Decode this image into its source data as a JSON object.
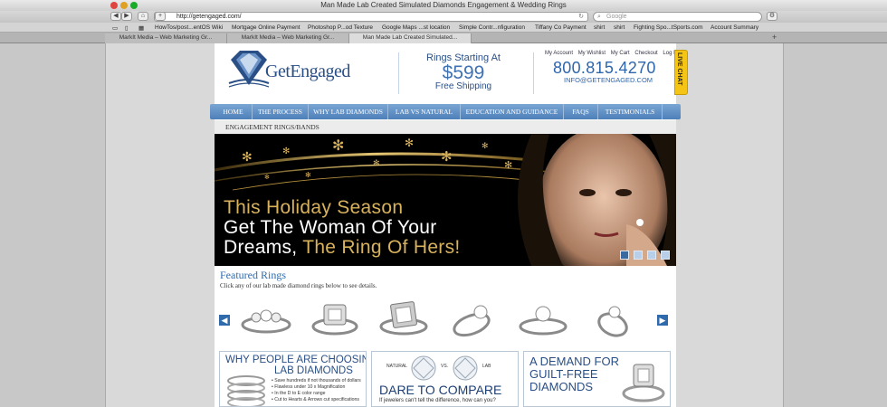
{
  "browser": {
    "window_title": "Man Made Lab Created Simulated Diamonds Engagement & Wedding Rings",
    "url": "http://getengaged.com/",
    "search_placeholder": "Google",
    "bookmarks": [
      "HowTos/post...entOS Wiki",
      "Mortgage Online Payment",
      "Photoshop P...od Texture",
      "Google Maps ...st location",
      "Simple Contr...nfiguration",
      "Tiffany Co Payment",
      "shirt",
      "shirt",
      "Fighting Spo...tSports.com",
      "Account Summary"
    ],
    "tabs": [
      "MarkIt Media – Web Marketing Gr...",
      "MarkIt Media – Web Marketing Gr...",
      "Man Made Lab Created Simulated..."
    ],
    "active_tab": 2
  },
  "header": {
    "logo_text": "GetEngaged",
    "promo_line1": "Rings Starting At",
    "promo_price": "$599",
    "promo_line3": "Free Shipping",
    "account_links": [
      "My Account",
      "My Wishlist",
      "My Cart",
      "Checkout",
      "Log In"
    ],
    "phone": "800.815.4270",
    "email": "INFO@GETENGAGED.COM",
    "live_chat": "LIVE CHAT"
  },
  "nav": {
    "items": [
      "HOME",
      "THE PROCESS",
      "WHY LAB DIAMONDS",
      "LAB VS NATURAL",
      "EDUCATION AND GUIDANCE",
      "FAQS",
      "TESTIMONIALS"
    ],
    "sub_item": "ENGAGEMENT RINGS/BANDS"
  },
  "hero": {
    "line1": "This Holiday Season",
    "line2": "Get The Woman Of Your",
    "line3a": "Dreams, ",
    "line3b": "The Ring Of Hers!",
    "slides": 4,
    "active_slide": 1
  },
  "featured": {
    "title": "Featured Rings",
    "subtitle": "Click any of our lab made diamond rings below to see details.",
    "rings": [
      "three-stone-ring",
      "emerald-cut-halo-ring",
      "princess-cut-halo-ring",
      "solitaire-ring",
      "pave-solitaire-ring",
      "twist-solitaire-ring"
    ]
  },
  "panels": {
    "why": {
      "line1": "WHY PEOPLE ARE CHOOSING",
      "line2": "LAB DIAMONDS",
      "bullets": [
        "Save hundreds if not thousands of dollars",
        "Flawless under 10 x Magnification",
        "In the D to E color range",
        "Cut to Hearts & Arrows cut specifications"
      ]
    },
    "compare": {
      "label_natural": "NATURAL",
      "label_vs": "VS.",
      "label_lab": "LAB",
      "title": "DARE TO COMPARE",
      "text": "If jewelers can't tell the difference, how can you?"
    },
    "demand": {
      "line1": "A DEMAND FOR",
      "line2": "GUILT-FREE",
      "line3": "DIAMONDS"
    }
  },
  "colors": {
    "brand_blue": "#2a4f86",
    "accent_gold": "#d8b25c",
    "nav_blue": "#4d7fb8",
    "chat_yellow": "#f4c416"
  }
}
